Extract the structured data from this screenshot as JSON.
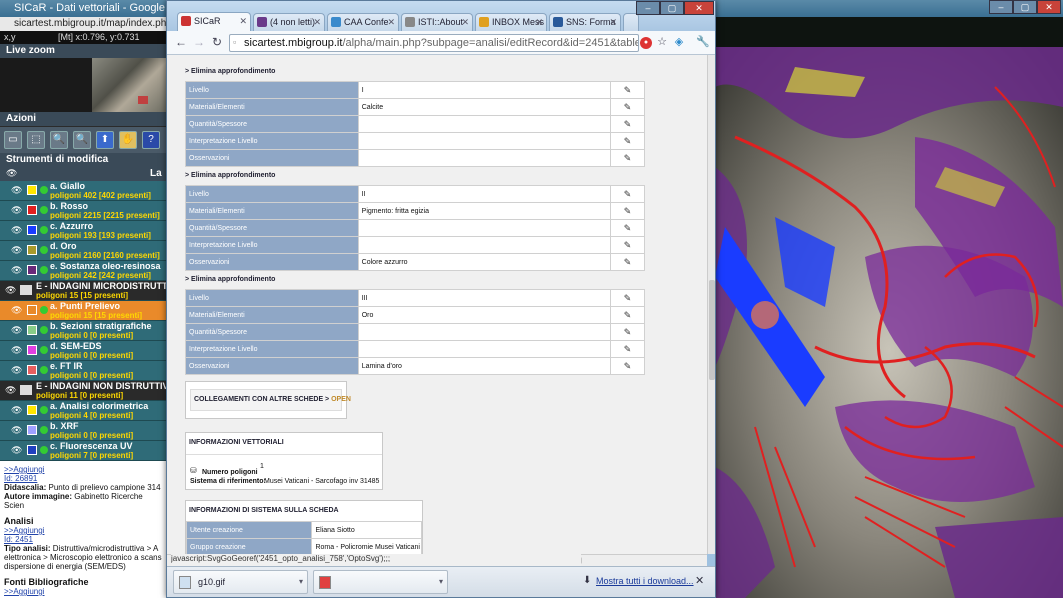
{
  "bg_window": {
    "title": "SICaR - Dati vettoriali - Google Chrome",
    "url": "sicartest.mbigroup.it/map/index.php?sysre",
    "coord_label": "x,y",
    "coord_value": "[Mt] x:0.796, y:0.731",
    "live_zoom": "Live zoom",
    "azioni": "Azioni",
    "strumenti": "Strumenti di modifica",
    "layers_header": "La",
    "tools": [
      "▭",
      "⬚",
      "🔍",
      "🔍",
      "⬆",
      "✋",
      "?"
    ],
    "layers": [
      {
        "name": "a. Giallo",
        "sub": "poligoni 402 [402 presenti]",
        "color": "#ffe600",
        "type": "item"
      },
      {
        "name": "b. Rosso",
        "sub": "poligoni 2215 [2215 presenti]",
        "color": "#e02020",
        "type": "item"
      },
      {
        "name": "c. Azzurro",
        "sub": "poligoni 193 [193 presenti]",
        "color": "#1a3cff",
        "type": "item"
      },
      {
        "name": "d. Oro",
        "sub": "poligoni 2160 [2160 presenti]",
        "color": "#a89a2a",
        "type": "item"
      },
      {
        "name": "e. Sostanza oleo-resinosa",
        "sub": "poligoni 242 [242 presenti]",
        "color": "#6a2a7a",
        "type": "item"
      },
      {
        "name": "E - INDAGINI MICRODISTRUTTI",
        "sub": "poligoni 15 [15 presenti]",
        "color": "",
        "type": "group"
      },
      {
        "name": "a. Punti Prelievo",
        "sub": "poligoni 15 [15 presenti]",
        "color": "#e98a2a",
        "type": "sel"
      },
      {
        "name": "b. Sezioni stratigrafiche",
        "sub": "poligoni 0 [0 presenti]",
        "color": "#88cc88",
        "type": "item"
      },
      {
        "name": "d. SEM-EDS",
        "sub": "poligoni 0 [0 presenti]",
        "color": "#e040e0",
        "type": "item"
      },
      {
        "name": "e. FT IR",
        "sub": "poligoni 0 [0 presenti]",
        "color": "#e86060",
        "type": "item"
      },
      {
        "name": "E - INDAGINI NON DISTRUTTIV",
        "sub": "poligoni 11 [0 presenti]",
        "color": "",
        "type": "group"
      },
      {
        "name": "a. Analisi colorimetrica",
        "sub": "poligoni 4 [0 presenti]",
        "color": "#ffe600",
        "type": "item"
      },
      {
        "name": "b. XRF",
        "sub": "poligoni 0 [0 presenti]",
        "color": "#a0a0ff",
        "type": "item"
      },
      {
        "name": "c. Fluorescenza UV",
        "sub": "poligoni 7 [0 presenti]",
        "color": "#2040c0",
        "type": "item"
      }
    ],
    "info": {
      "link1": ">>Aggiungi",
      "id1": "Id: 26891",
      "didascalia_label": "Didascalia:",
      "didascalia": "Punto di prelievo campione 314",
      "autore_label": "Autore immagine:",
      "autore": "Gabinetto Ricerche Scien",
      "analisi_h": "Analisi",
      "link2": ">>Aggiungi",
      "id2": "Id: 2451",
      "tipo_label": "Tipo analisi:",
      "tipo": "Distruttiva/microdistruttiva > A elettronica > Microscopio elettronico a scans dispersione di energia (SEM/EDS)",
      "fonti_h": "Fonti Bibliografiche",
      "link3": ">>Aggiungi"
    }
  },
  "chrome": {
    "tabs": [
      {
        "label": "SICaR",
        "color": "#cc3333",
        "active": true
      },
      {
        "label": "(4 non letti)",
        "color": "#6a3a8a",
        "active": false
      },
      {
        "label": "CAA Confe",
        "color": "#3a8acc",
        "active": false
      },
      {
        "label": "ISTI::About",
        "color": "#888888",
        "active": false
      },
      {
        "label": "INBOX Mess",
        "color": "#e0a020",
        "active": false
      },
      {
        "label": "SNS: Forma",
        "color": "#2a5a9a",
        "active": false
      }
    ],
    "url_host": "sicartest.mbigroup.it",
    "url_path": "/alpha/main.php?subpage=analisi/editRecord&id=2451&tableNam",
    "status_url": "javascript:SvgGoGeoref('2451_opto_analisi_758','OptoSvg');;;",
    "downloads": [
      {
        "name": "g10.gif"
      },
      {
        "name": ""
      }
    ],
    "show_all": "Mostra tutti i download...",
    "close_x": "✕"
  },
  "record": {
    "elimina": "> Elimina approfondimento",
    "blocks": [
      {
        "rows": [
          {
            "label": "Livello",
            "value": "I"
          },
          {
            "label": "Materiali/Elementi",
            "value": "Calcite"
          },
          {
            "label": "Quantità/Spessore",
            "value": ""
          },
          {
            "label": "Interpretazione Livello",
            "value": ""
          },
          {
            "label": "Osservazioni",
            "value": ""
          }
        ]
      },
      {
        "rows": [
          {
            "label": "Livello",
            "value": "II"
          },
          {
            "label": "Materiali/Elementi",
            "value": "Pigmento: fritta egizia"
          },
          {
            "label": "Quantità/Spessore",
            "value": ""
          },
          {
            "label": "Interpretazione Livello",
            "value": ""
          },
          {
            "label": "Osservazioni",
            "value": "Colore azzurro"
          }
        ]
      },
      {
        "rows": [
          {
            "label": "Livello",
            "value": "III"
          },
          {
            "label": "Materiali/Elementi",
            "value": "Oro"
          },
          {
            "label": "Quantità/Spessore",
            "value": ""
          },
          {
            "label": "Interpretazione Livello",
            "value": ""
          },
          {
            "label": "Osservazioni",
            "value": "Lamina d'oro"
          }
        ]
      }
    ],
    "collegamenti": "COLLEGAMENTI CON ALTRE SCHEDE >",
    "open": "OPEN",
    "info_vett_h": "INFORMAZIONI VETTORIALI",
    "num_poligoni_label": "Numero poligoni",
    "num_poligoni": "1",
    "sistema_label": "Sistema di riferimento:",
    "sistema": "Musei Vaticani - Sarcofago inv 31485",
    "info_sis_h": "INFORMAZIONI DI SISTEMA SULLA SCHEDA",
    "sys_rows": [
      {
        "label": "Utente creazione",
        "value": "Eliana Siotto"
      },
      {
        "label": "Gruppo creazione",
        "value": "Roma - Policromie Musei Vaticani"
      }
    ],
    "edit_icon": "✎"
  }
}
